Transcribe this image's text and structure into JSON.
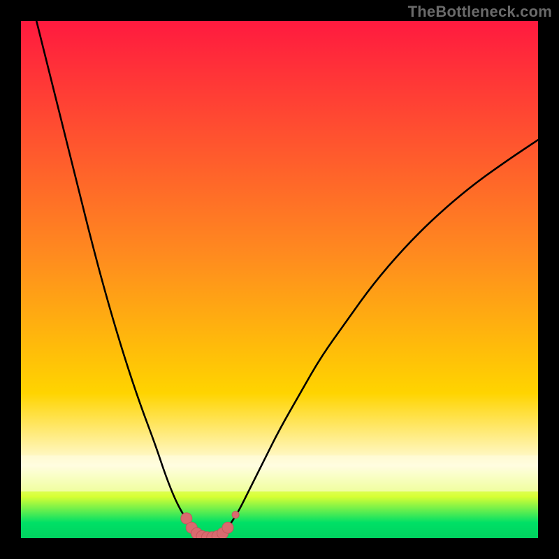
{
  "watermark": "TheBottleneck.com",
  "colors": {
    "frame_bg": "#000000",
    "grad_top": "#ff1a3f",
    "grad_mid": "#ffd400",
    "grad_yellowgreen": "#d7ff33",
    "grad_green": "#00e066",
    "grad_bottom": "#00d25f",
    "curve": "#000000",
    "band_pale": "#fffde0",
    "marker_fill": "#d96a6f",
    "marker_stroke": "#c3585e"
  },
  "chart_data": {
    "type": "line",
    "title": "",
    "xlabel": "",
    "ylabel": "",
    "xlim": [
      0,
      100
    ],
    "ylim": [
      0,
      100
    ],
    "series": [
      {
        "name": "bottleneck-curve",
        "x": [
          3,
          5,
          8,
          11,
          14,
          17,
          20,
          23,
          26,
          28,
          30,
          32,
          33.5,
          35,
          36,
          37,
          38,
          39,
          40,
          42,
          44,
          47,
          50,
          54,
          58,
          63,
          68,
          74,
          80,
          87,
          94,
          100
        ],
        "y": [
          100,
          92,
          80,
          68,
          56,
          45,
          35,
          26,
          18,
          12,
          7,
          3.5,
          1.6,
          0.6,
          0.25,
          0.15,
          0.25,
          0.8,
          2,
          5,
          9,
          15,
          21,
          28,
          35,
          42,
          49,
          56,
          62,
          68,
          73,
          77
        ]
      }
    ],
    "markers": {
      "name": "highlight-dots",
      "points": [
        {
          "x": 32.0,
          "y": 3.8
        },
        {
          "x": 33.0,
          "y": 2.0
        },
        {
          "x": 34.0,
          "y": 0.9
        },
        {
          "x": 35.0,
          "y": 0.35
        },
        {
          "x": 36.0,
          "y": 0.15
        },
        {
          "x": 37.0,
          "y": 0.15
        },
        {
          "x": 38.0,
          "y": 0.35
        },
        {
          "x": 39.0,
          "y": 0.9
        },
        {
          "x": 40.0,
          "y": 2.0
        },
        {
          "x": 41.5,
          "y": 4.5
        }
      ],
      "radius_default": 8,
      "radius_satellite": 5
    }
  }
}
